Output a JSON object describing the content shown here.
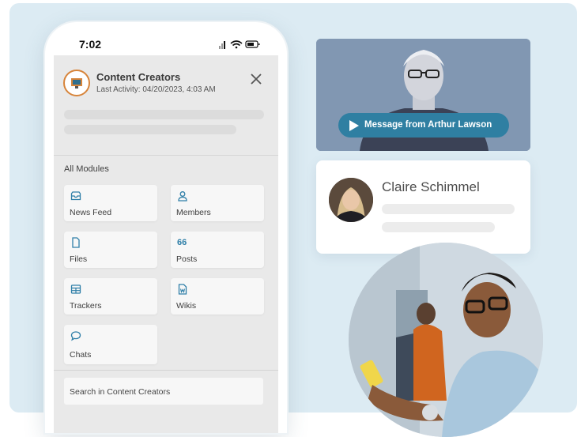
{
  "phone": {
    "status_time": "7:02",
    "group": {
      "name": "Content Creators",
      "last_activity": "Last Activity: 04/20/2023, 4:03 AM",
      "logo_icon": "group-logo-icon",
      "close_icon": "close-icon"
    },
    "modules_label": "All Modules",
    "modules": [
      {
        "label": "News Feed",
        "icon": "inbox-icon",
        "glyph": "▭"
      },
      {
        "label": "Members",
        "icon": "person-icon",
        "glyph": "♙"
      },
      {
        "label": "Files",
        "icon": "file-icon",
        "glyph": "▯"
      },
      {
        "label": "Posts",
        "icon": "quote-icon",
        "glyph": "66"
      },
      {
        "label": "Trackers",
        "icon": "table-icon",
        "glyph": "⊞"
      },
      {
        "label": "Wikis",
        "icon": "document-w-icon",
        "glyph": "W"
      },
      {
        "label": "Chats",
        "icon": "chat-bubble-icon",
        "glyph": "○"
      }
    ],
    "search_placeholder": "Search in Content Creators"
  },
  "video": {
    "button_label": "Message from Arthur Lawson",
    "icon": "play-icon"
  },
  "contact": {
    "name": "Claire Schimmel"
  },
  "colors": {
    "accent": "#2f7fa2",
    "background": "#dcebf3",
    "logo_ring": "#d7843a"
  }
}
